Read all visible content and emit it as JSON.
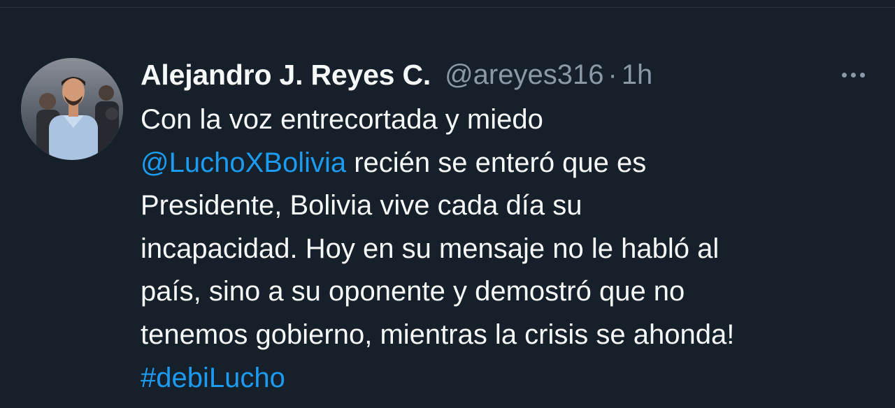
{
  "tweet": {
    "author": {
      "display_name": "Alejandro J. Reyes C.",
      "handle": "@areyes316",
      "separator": "·",
      "time": "1h"
    },
    "more_icon": "more-horizontal-icon",
    "text": {
      "line1": "Con la voz entrecortada y miedo",
      "mention": "@LuchoXBolivia",
      "line2_rest": " recién se enteró que es",
      "line3": "Presidente, Bolivia vive cada día su",
      "line4": "incapacidad. Hoy en su mensaje no le habló al",
      "line5": "país, sino a su oponente y demostró que no",
      "line6": "tenemos gobierno, mientras la crisis se ahonda!",
      "hashtag": "#debiLucho"
    }
  },
  "colors": {
    "background": "#15202b",
    "text_primary": "#f7f9f9",
    "text_secondary": "#8b98a5",
    "link": "#1d9bf0"
  }
}
